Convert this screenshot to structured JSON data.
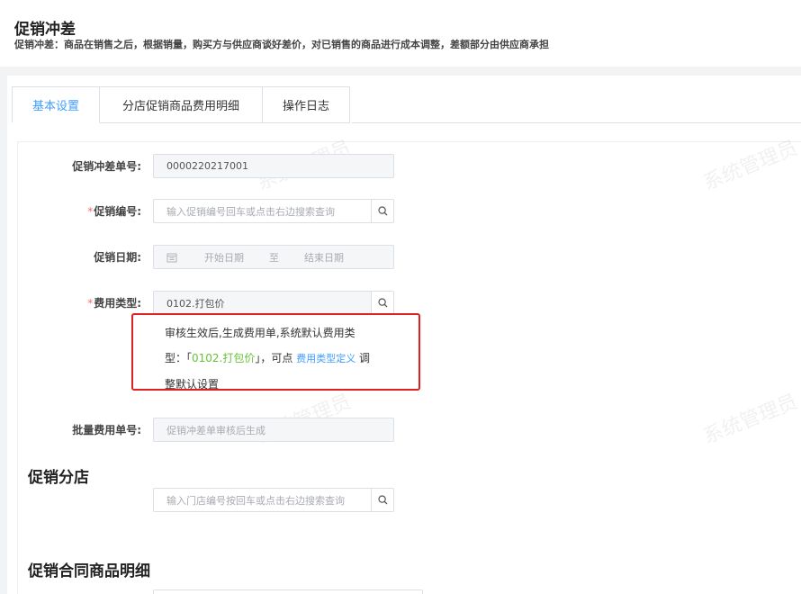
{
  "header": {
    "title": "促销冲差",
    "description": "促销冲差：商品在销售之后，根据销量，购买方与供应商谈好差价，对已销售的商品进行成本调整，差额部分由供应商承担"
  },
  "tabs": [
    {
      "label": "基本设置",
      "active": true
    },
    {
      "label": "分店促销商品费用明细",
      "active": false
    },
    {
      "label": "操作日志",
      "active": false
    }
  ],
  "form": {
    "order_no": {
      "label": "促销冲差单号:",
      "value": "0000220217001"
    },
    "promo_no": {
      "label": "促销编号:",
      "required_mark": "*",
      "placeholder": "输入促销编号回车或点击右边搜索查询"
    },
    "promo_date": {
      "label": "促销日期:",
      "start_placeholder": "开始日期",
      "separator": "至",
      "end_placeholder": "结束日期"
    },
    "fee_type": {
      "label": "费用类型:",
      "required_mark": "*",
      "value": "0102.打包价"
    },
    "batch_fee_no": {
      "label": "批量费用单号:",
      "placeholder": "促销冲差单审核后生成"
    }
  },
  "tip": {
    "line1": "审核生效后,生成费用单,系统默认费用类",
    "line2_prefix": "型：「",
    "highlight": "0102.打包价",
    "line2_mid": "」，可点 ",
    "link": "费用类型定义",
    "line2_suffix": " 调",
    "line3": "整默认设置"
  },
  "sections": {
    "store_title": "促销分店",
    "store_placeholder": "输入门店编号按回车或点击右边搜索查询",
    "contract_title": "促销合同商品明细"
  },
  "watermark": "系统管理员",
  "colors": {
    "accent": "#409eff",
    "required": "#f56c6c",
    "highlight": "#67c23a",
    "annotation": "#e02020"
  }
}
